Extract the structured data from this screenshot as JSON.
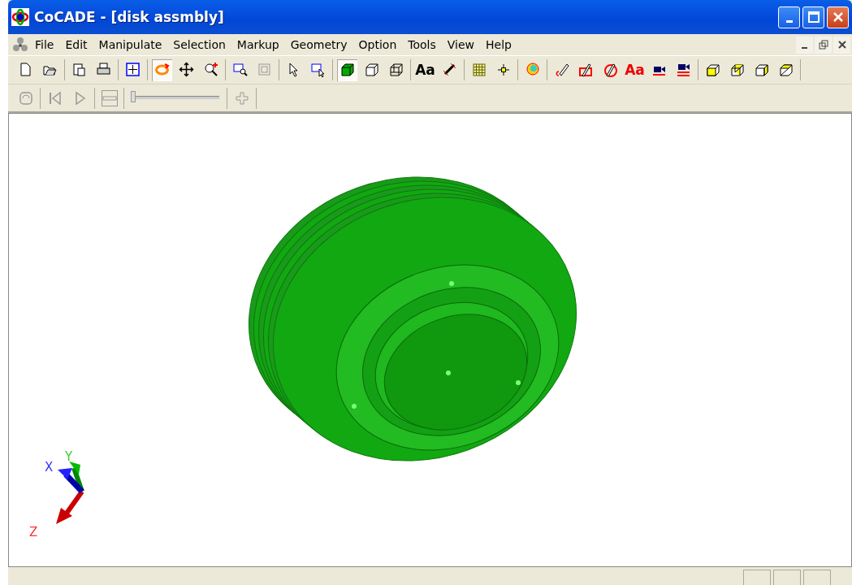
{
  "window": {
    "title": "CoCADE - [disk assmbly]"
  },
  "menu": [
    "File",
    "Edit",
    "Manipulate",
    "Selection",
    "Markup",
    "Geometry",
    "Option",
    "Tools",
    "View",
    "Help"
  ],
  "toolbar": [
    [
      {
        "kind": "new",
        "pressed": false
      },
      {
        "kind": "open",
        "pressed": false
      }
    ],
    [
      {
        "kind": "paste",
        "pressed": false
      },
      {
        "kind": "print",
        "pressed": false
      }
    ],
    [
      {
        "kind": "fit",
        "pressed": false
      }
    ],
    [
      {
        "kind": "rotate",
        "pressed": true
      },
      {
        "kind": "pan",
        "pressed": false
      },
      {
        "kind": "zoom",
        "pressed": false
      }
    ],
    [
      {
        "kind": "zoomwin",
        "pressed": false
      },
      {
        "kind": "zoomall",
        "pressed": false
      }
    ],
    [
      {
        "kind": "pointer",
        "pressed": false
      },
      {
        "kind": "selwin",
        "pressed": false
      }
    ],
    [
      {
        "kind": "shaded",
        "pressed": true
      },
      {
        "kind": "wire",
        "pressed": false
      },
      {
        "kind": "hidden",
        "pressed": false
      }
    ],
    [
      {
        "kind": "text",
        "label": "Aa",
        "pressed": false
      },
      {
        "kind": "dimension",
        "pressed": false
      }
    ],
    [
      {
        "kind": "grid",
        "pressed": false
      },
      {
        "kind": "point",
        "pressed": false
      }
    ],
    [
      {
        "kind": "orbit",
        "pressed": false
      }
    ],
    [
      {
        "kind": "pen",
        "pressed": false
      },
      {
        "kind": "rectmark",
        "pressed": false
      },
      {
        "kind": "circlemark",
        "pressed": false
      },
      {
        "kind": "redtext",
        "label": "Aa",
        "pressed": false
      },
      {
        "kind": "camera",
        "pressed": false
      },
      {
        "kind": "camera2",
        "pressed": false
      }
    ],
    [
      {
        "kind": "ycube1",
        "pressed": false
      },
      {
        "kind": "ycube2",
        "pressed": false
      },
      {
        "kind": "ycube3",
        "pressed": false
      },
      {
        "kind": "ycube4",
        "pressed": false
      }
    ]
  ],
  "playbar": [
    {
      "kind": "loop",
      "disabled": true
    },
    {
      "kind": "first",
      "disabled": true
    },
    {
      "kind": "play",
      "disabled": true
    },
    {
      "kind": "minus",
      "disabled": true
    },
    {
      "kind": "slider",
      "level": 0.0
    },
    {
      "kind": "plus",
      "disabled": true
    }
  ],
  "axes": {
    "x": "X",
    "y": "Y",
    "z": "Z"
  }
}
